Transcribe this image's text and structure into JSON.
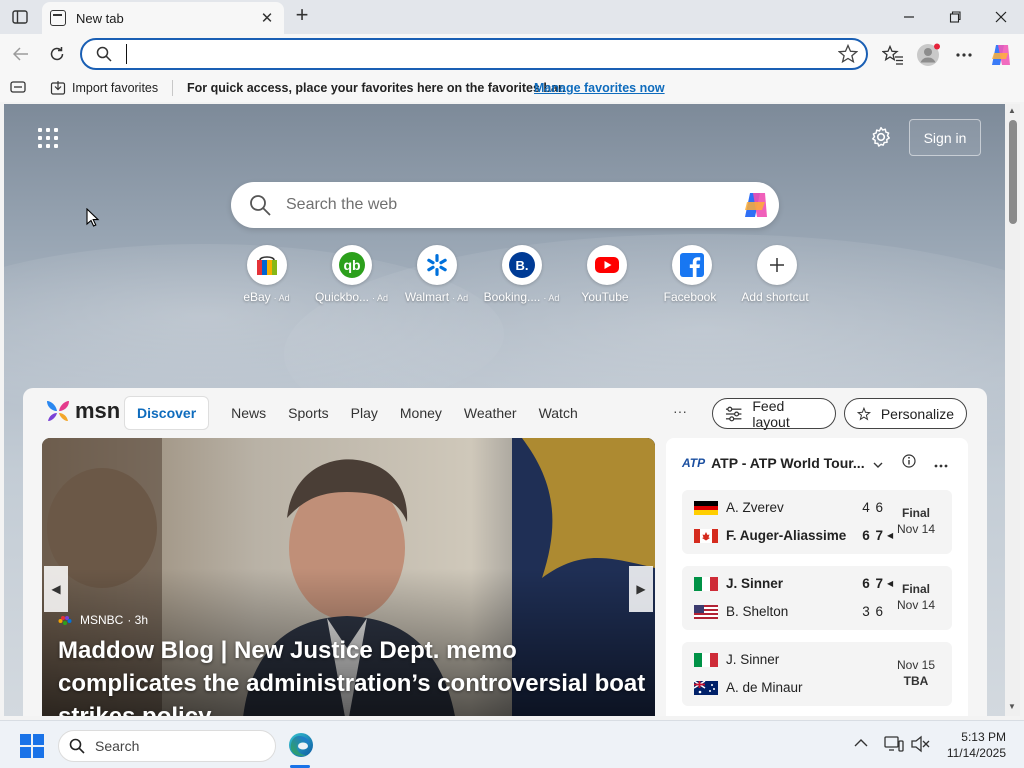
{
  "browser": {
    "tab": {
      "title": "New tab",
      "close_glyph": "✕"
    },
    "newtab_glyph": "+",
    "window_controls": {
      "minimize": "—",
      "maximize": "❐",
      "close": "✕"
    },
    "address": {
      "value": "",
      "placeholder": ""
    }
  },
  "favorites_bar": {
    "import_label": "Import favorites",
    "hint": "For quick access, place your favorites here on the favorites bar.",
    "manage_link": "Manage favorites now"
  },
  "newtab": {
    "signin_label": "Sign in",
    "search_placeholder": "Search the web",
    "shortcuts": [
      {
        "label": "eBay",
        "ad": "· Ad",
        "icon": "ebay-icon"
      },
      {
        "label": "Quickbo...",
        "ad": "· Ad",
        "icon": "quickbooks-icon"
      },
      {
        "label": "Walmart",
        "ad": "· Ad",
        "icon": "walmart-icon"
      },
      {
        "label": "Booking....",
        "ad": "· Ad",
        "icon": "booking-icon"
      },
      {
        "label": "YouTube",
        "ad": "",
        "icon": "youtube-icon"
      },
      {
        "label": "Facebook",
        "ad": "",
        "icon": "facebook-icon"
      },
      {
        "label": "Add shortcut",
        "ad": "",
        "icon": "plus-icon"
      }
    ]
  },
  "feed": {
    "logo": "msn",
    "nav": [
      "Discover",
      "News",
      "Sports",
      "Play",
      "Money",
      "Weather",
      "Watch"
    ],
    "more": "···",
    "feed_layout_label": "Feed layout",
    "personalize_label": "Personalize",
    "hero": {
      "source": "MSNBC",
      "age": "· 3h",
      "title": "Maddow Blog | New Justice Dept. memo complicates the administration’s controversial boat strikes policy"
    },
    "scores": {
      "league": "ATP - ATP World Tour...",
      "matches": [
        {
          "p1": {
            "name": "A. Zverev",
            "score": "4 6",
            "flag": "germany",
            "winner": false,
            "serve": ""
          },
          "p2": {
            "name": "F. Auger-Aliassime",
            "score": "6 7",
            "flag": "canada",
            "winner": true,
            "serve": "◀"
          },
          "status": "Final",
          "date": "Nov 14"
        },
        {
          "p1": {
            "name": "J. Sinner",
            "score": "6 7",
            "flag": "italy",
            "winner": true,
            "serve": "◀"
          },
          "p2": {
            "name": "B. Shelton",
            "score": "3 6",
            "flag": "usa",
            "winner": false,
            "serve": ""
          },
          "status": "Final",
          "date": "Nov 14"
        },
        {
          "p1": {
            "name": "J. Sinner",
            "score": "",
            "flag": "italy",
            "winner": false,
            "serve": ""
          },
          "p2": {
            "name": "A. de Minaur",
            "score": "",
            "flag": "australia",
            "winner": false,
            "serve": ""
          },
          "status": "TBA",
          "date": "Nov 15"
        }
      ]
    }
  },
  "taskbar": {
    "search_label": "Search",
    "time": "5:13 PM",
    "date": "11/14/2025"
  },
  "colors": {
    "accent": "#0f6cbd",
    "address_border": "#1a5fb4",
    "windows_blue": "#1a73e8"
  }
}
